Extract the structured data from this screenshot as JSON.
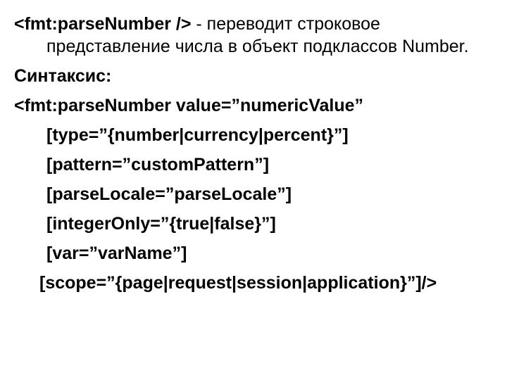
{
  "intro": {
    "tag": "<fmt:parseNumber />",
    "desc": " - переводит строковое представление числа в объект подклассов Number."
  },
  "syntax_label": "Синтаксис:",
  "syntax": {
    "open": "<fmt:parseNumber value=”numericValue”",
    "type": "[type=”{number|currency|percent}”]",
    "pattern": "[pattern=”customPattern”]",
    "parseLocale": "[parseLocale=”parseLocale”]",
    "integerOnly": "[integerOnly=”{true|false}”]",
    "var": "[var=”varName”]",
    "scope": "[scope=”{page|request|session|application}”]/>"
  }
}
